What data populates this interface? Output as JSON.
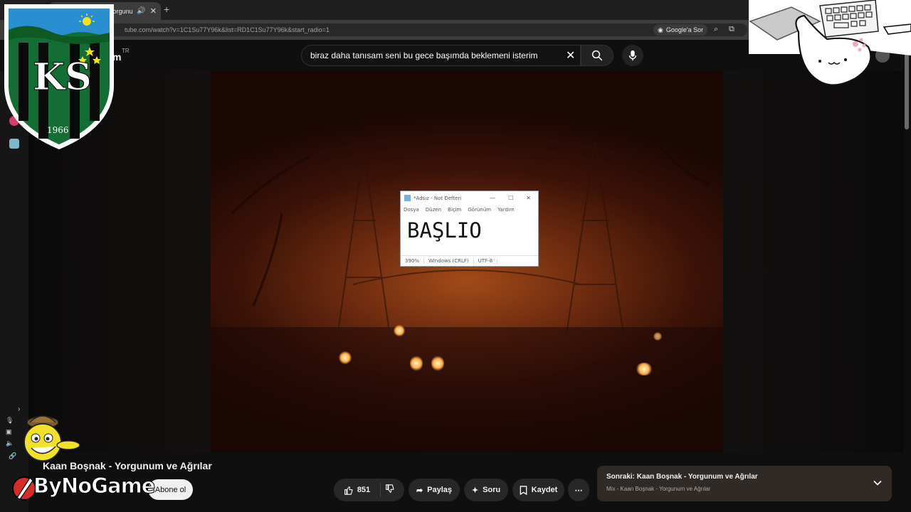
{
  "browser": {
    "tab_title": "Kaan Boşnak - Yorgunum ve",
    "new_tab": "+",
    "url": "tube.com/watch?v=1C1Su77Y96k&list=RD1C1Su77Y96k&start_radio=1",
    "google_lens": "Google'a Sor"
  },
  "youtube": {
    "region": "TR",
    "logo_partial": "m",
    "search_value": "biraz daha tanısam seni bu gece başımda beklemeni isterim"
  },
  "notepad": {
    "title": "*Adsız - Not Defteri",
    "menu": [
      "Dosya",
      "Düzen",
      "Biçim",
      "Görünüm",
      "Yardım"
    ],
    "content": "BAŞLIO",
    "status": [
      "390%",
      "Windows (CRLF)",
      "UTF-8"
    ]
  },
  "video": {
    "title": "Kaan Boşnak - Yorgunum ve Ağrılar",
    "subscribe": "Abone ol",
    "likes": "851",
    "share": "Paylaş",
    "ask": "Soru",
    "save": "Kaydet"
  },
  "up_next": {
    "title": "Sonraki: Kaan Boşnak - Yorgunum ve Ağrılar",
    "subtitle": "Mix - Kaan Boşnak - Yorgunum ve Ağrılar"
  },
  "overlays": {
    "crest_initials": "KS",
    "crest_year": "1966",
    "brand": "ByNoGame"
  },
  "colors": {
    "accent_red": "#ff0000",
    "crest_green": "#1a7a3a",
    "background": "#0f0f0f"
  }
}
